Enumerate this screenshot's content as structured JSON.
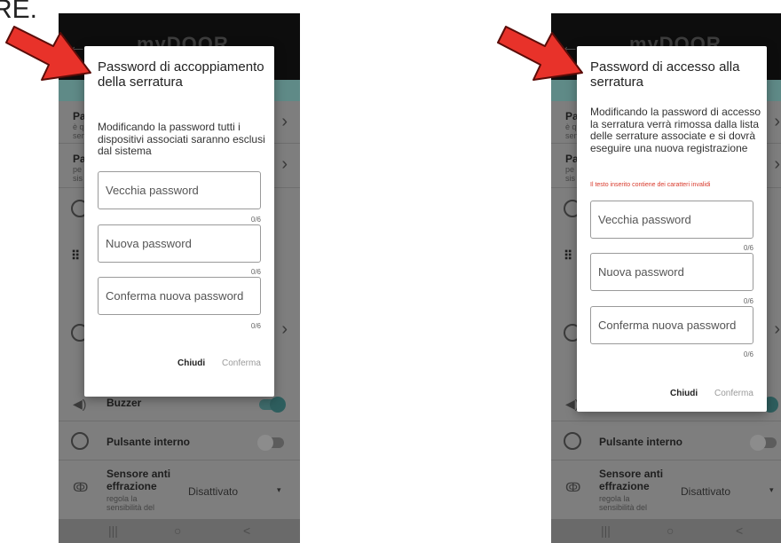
{
  "caption_text": "RE.",
  "background_app": {
    "brand": "myDOOR",
    "rows_left": [
      {
        "title": "Pa",
        "sub": "è q sen"
      },
      {
        "title": "Pa",
        "sub": "pe sis"
      }
    ],
    "buzzer_label": "Buzzer",
    "pulsante_label": "Pulsante interno",
    "sensore_title": "Sensore anti effrazione",
    "sensore_sub": "regola la sensibilità del",
    "sensore_value": "Disattivato",
    "nav": {
      "recent": "|||",
      "home": "○",
      "back": "<"
    }
  },
  "left_dialog": {
    "title": "Password di accoppiamento della serratura",
    "message": "Modificando la password tutti i dispositivi associati saranno esclusi dal sistema",
    "fields": [
      {
        "placeholder": "Vecchia password",
        "counter": "0/6"
      },
      {
        "placeholder": "Nuova password",
        "counter": "0/6"
      },
      {
        "placeholder": "Conferma nuova password",
        "counter": "0/6"
      }
    ],
    "close_label": "Chiudi",
    "confirm_label": "Conferma"
  },
  "right_dialog": {
    "title": "Password di accesso alla serratura",
    "message": "Modificando la password di accesso la serratura verrà rimossa dalla lista delle serrature associate e si dovrà eseguire una nuova registrazione",
    "error": "Il testo inserito contiene dei caratteri invalidi",
    "fields": [
      {
        "placeholder": "Vecchia password",
        "counter": "0/6"
      },
      {
        "placeholder": "Nuova password",
        "counter": "0/6"
      },
      {
        "placeholder": "Conferma nuova password",
        "counter": "0/6"
      }
    ],
    "close_label": "Chiudi",
    "confirm_label": "Conferma"
  },
  "colors": {
    "arrow": "#e8322a",
    "error": "#d8392b",
    "teal": "#5f8a87"
  },
  "icons": [
    "red-arrow-icon",
    "speaker-icon",
    "chevron-right-icon",
    "toggle-switch"
  ]
}
